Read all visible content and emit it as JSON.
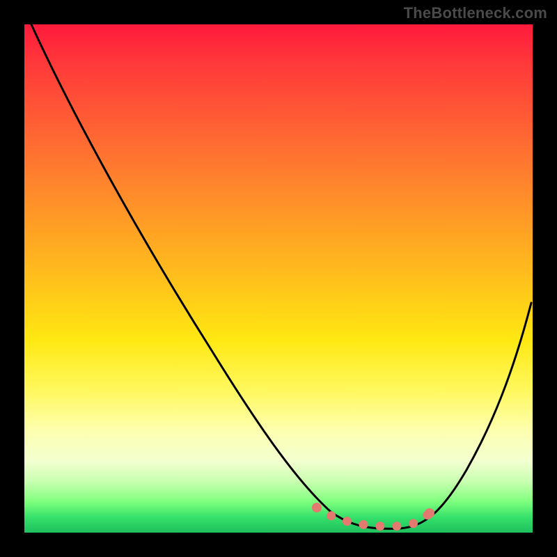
{
  "watermark": {
    "text": "TheBottleneck.com"
  },
  "chart_data": {
    "type": "line",
    "title": "",
    "xlabel": "",
    "ylabel": "",
    "xlim": [
      0,
      100
    ],
    "ylim": [
      0,
      100
    ],
    "grid": false,
    "legend": false,
    "series": [
      {
        "name": "bottleneck-curve",
        "x": [
          0,
          5,
          10,
          15,
          20,
          25,
          30,
          35,
          40,
          45,
          50,
          55,
          60,
          63,
          66,
          70,
          74,
          78,
          82,
          86,
          90,
          94,
          97,
          100
        ],
        "y": [
          100,
          92,
          84,
          76,
          68,
          60,
          52,
          44,
          36,
          28,
          21,
          14,
          8,
          4,
          2,
          1,
          1,
          1,
          3,
          8,
          16,
          26,
          36,
          46
        ]
      }
    ],
    "accent": {
      "name": "optimal-range-marker",
      "color": "#e27a70",
      "style": "dotted",
      "x": [
        58,
        62,
        66,
        70,
        74,
        78
      ],
      "y": [
        5,
        3,
        2,
        1,
        1,
        3
      ]
    },
    "background_gradient": {
      "top": "#ff1a3c",
      "middle": "#ffe812",
      "bottom": "#1fbf5d"
    }
  }
}
